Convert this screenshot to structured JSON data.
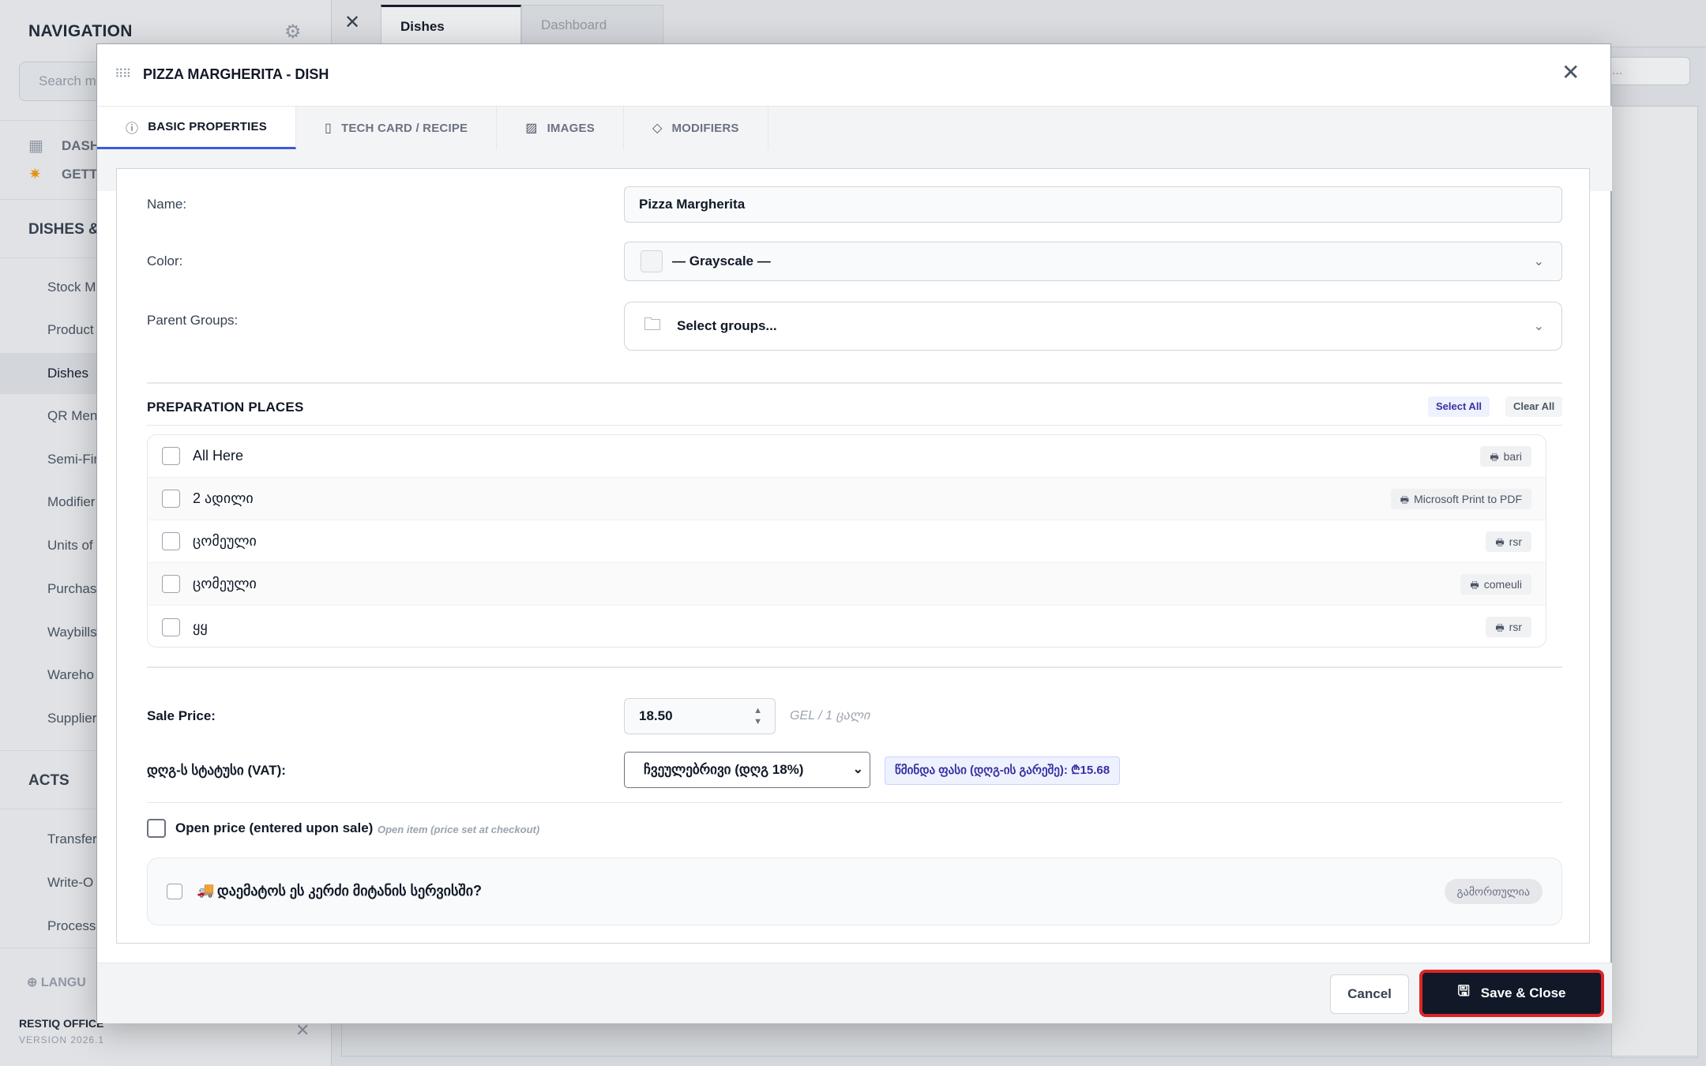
{
  "sidebar": {
    "title": "NAVIGATION",
    "search_placeholder": "Search m",
    "links": [
      "DASH",
      "GETTI"
    ],
    "section_dishes": "DISHES &",
    "items": [
      "Stock M",
      "Product",
      "Dishes",
      "QR Men",
      "Semi-Fir",
      "Modifier",
      "Units of",
      "Purchase",
      "Waybills",
      "Wareho",
      "Supplier"
    ],
    "active_item": "Dishes",
    "section_acts": "ACTS",
    "act_items": [
      "Transfer",
      "Write-O",
      "Processi"
    ],
    "language": "LANGU",
    "footer_name": "RESTIQ OFFICE",
    "footer_version": "VERSION 2026.1"
  },
  "topbar": {
    "tabs": [
      {
        "label": "Dishes",
        "active": true
      },
      {
        "label": "Dashboard",
        "active": false
      }
    ],
    "search_stub": "..."
  },
  "modal": {
    "title": "PIZZA MARGHERITA - DISH",
    "tabs": [
      {
        "label": "BASIC PROPERTIES",
        "icon": "info-icon",
        "active": true
      },
      {
        "label": "TECH CARD / RECIPE",
        "icon": "document-icon",
        "active": false
      },
      {
        "label": "IMAGES",
        "icon": "image-icon",
        "active": false
      },
      {
        "label": "MODIFIERS",
        "icon": "tag-icon",
        "active": false
      }
    ],
    "form": {
      "name_label": "Name:",
      "name_value": "Pizza Margherita",
      "color_label": "Color:",
      "color_value": "— Grayscale —",
      "groups_label": "Parent Groups:",
      "groups_placeholder": "Select groups...",
      "prep_title": "PREPARATION PLACES",
      "select_all": "Select All",
      "clear_all": "Clear All",
      "prep_places": [
        {
          "name": "All Here",
          "printer": "bari"
        },
        {
          "name": "2 ადილი",
          "printer": "Microsoft Print to PDF"
        },
        {
          "name": "ცომეული",
          "printer": "rsr"
        },
        {
          "name": "ცომეული",
          "printer": "comeuli"
        },
        {
          "name": "ყყ",
          "printer": "rsr"
        }
      ],
      "sale_price_label": "Sale Price:",
      "sale_price_value": "18.50",
      "sale_price_unit": "GEL / 1 ცალი",
      "vat_label": "დღგ-ს სტატუსი (VAT):",
      "vat_value": "ჩვეულებრივი (დღგ 18%)",
      "net_price_badge": "წმინდა ფასი (დღგ-ის გარეშე): ₾15.68",
      "open_price_label": "Open price (entered upon sale)",
      "open_price_hint": "Open item (price set at checkout)",
      "delivery_label": "დაემატოს ეს კერძი მიტანის სერვისში?",
      "delivery_status": "გამორთულია"
    },
    "footer": {
      "cancel": "Cancel",
      "save_close": "Save & Close"
    }
  },
  "colors": {
    "accent_tab": "#3b5bdb",
    "save_button_bg": "#111827",
    "save_button_outline": "#dc2626",
    "badge_text": "#3730a3"
  }
}
